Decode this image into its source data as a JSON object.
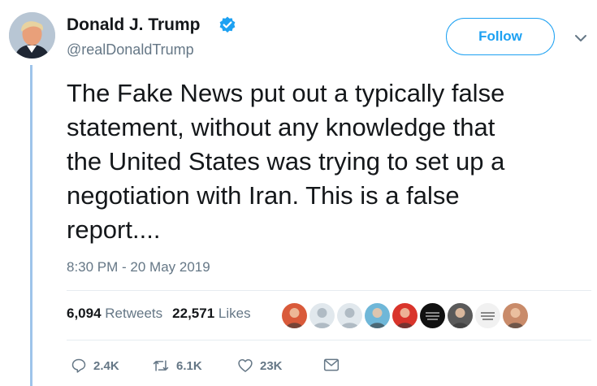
{
  "tweet": {
    "author_name": "Donald J. Trump",
    "handle": "@realDonaldTrump",
    "follow_label": "Follow",
    "text": "The Fake News put out a typically false\nstatement, without any knowledge that\nthe United States was trying to set up a\nnegotiation with Iran. This is a false\nreport....",
    "timestamp": "8:30 PM - 20 May 2019"
  },
  "stats": {
    "retweets_count": "6,094",
    "retweets_label": "Retweets",
    "likes_count": "22,571",
    "likes_label": "Likes"
  },
  "actions": {
    "reply_count": "2.4K",
    "retweet_count": "6.1K",
    "like_count": "23K"
  },
  "liker_avatars": [
    {
      "kind": "photo",
      "color": "#d95a3a"
    },
    {
      "kind": "default",
      "color": "#b0bbc4"
    },
    {
      "kind": "default",
      "color": "#b0bbc4"
    },
    {
      "kind": "photo",
      "color": "#6fb7d8"
    },
    {
      "kind": "photo",
      "color": "#d9342b"
    },
    {
      "kind": "logo",
      "color": "#111111"
    },
    {
      "kind": "photo",
      "color": "#5a5a5a"
    },
    {
      "kind": "logo",
      "color": "#f1f1f1"
    },
    {
      "kind": "photo",
      "color": "#c98b6a"
    }
  ],
  "colors": {
    "accent": "#1da1f2",
    "text_primary": "#14171a",
    "text_secondary": "#657786",
    "thread_line": "#9ec4ea"
  }
}
